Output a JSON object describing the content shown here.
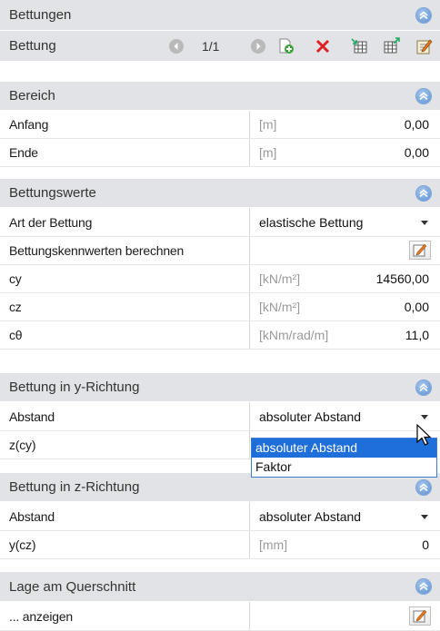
{
  "sections": {
    "bettungen": "Bettungen",
    "bereich": "Bereich",
    "bettungswerte": "Bettungswerte",
    "y_richtung": "Bettung in y-Richtung",
    "z_richtung": "Bettung in z-Richtung",
    "lage": "Lage am Querschnitt"
  },
  "toolbar": {
    "label": "Bettung",
    "counter": "1/1"
  },
  "rows": {
    "anfang": {
      "label": "Anfang",
      "unit": "[m]",
      "value": "0,00"
    },
    "ende": {
      "label": "Ende",
      "unit": "[m]",
      "value": "0,00"
    },
    "art": {
      "label": "Art der Bettung",
      "value": "elastische Bettung"
    },
    "berechnen": {
      "label": "Bettungskennwerten berechnen"
    },
    "cy": {
      "label": "cy",
      "unit": "[kN/m²]",
      "value": "14560,00"
    },
    "cz": {
      "label": "cz",
      "unit": "[kN/m²]",
      "value": "0,00"
    },
    "ctheta": {
      "label": "cθ",
      "unit": "[kNm/rad/m]",
      "value": "11,0"
    },
    "abstand_y": {
      "label": "Abstand",
      "value": "absoluter Abstand"
    },
    "z_cy": {
      "label": "z(cy)"
    },
    "abstand_z": {
      "label": "Abstand",
      "value": "absoluter Abstand"
    },
    "y_cz": {
      "label": "y(cz)",
      "unit": "[mm]",
      "value": "0"
    },
    "anzeigen": {
      "label": "... anzeigen"
    }
  },
  "dropdown": {
    "options": [
      "absoluter Abstand",
      "Faktor"
    ],
    "highlighted": "absoluter Abstand"
  },
  "icons": [
    "prev-icon",
    "next-icon",
    "add-icon",
    "delete-icon",
    "table-import-icon",
    "table-export-icon",
    "edit-icon",
    "collapse-icon",
    "mouse-cursor-icon"
  ],
  "colors": {
    "header_bg": "#e1e3e6",
    "accent": "#1e6fd9",
    "unit_text": "#9a9a9a"
  }
}
